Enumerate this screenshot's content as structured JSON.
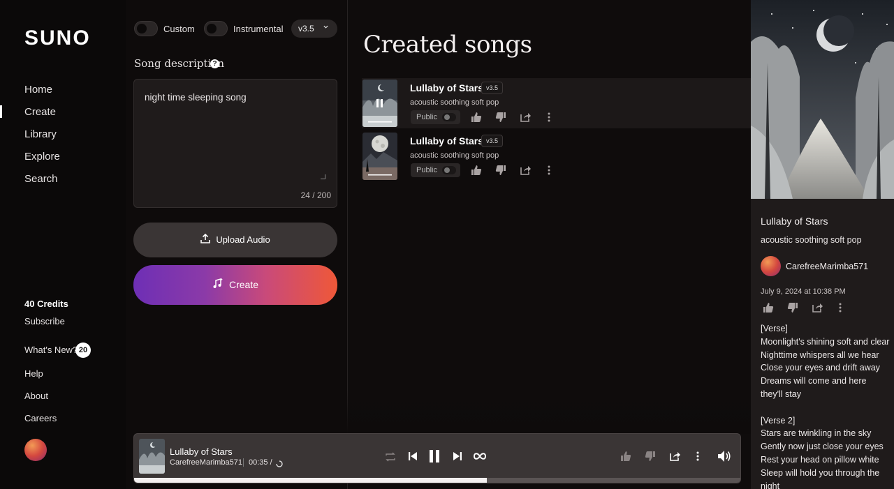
{
  "brand": "SUNO",
  "nav": [
    {
      "label": "Home"
    },
    {
      "label": "Create"
    },
    {
      "label": "Library"
    },
    {
      "label": "Explore"
    },
    {
      "label": "Search"
    }
  ],
  "active_nav": "Create",
  "sidebar": {
    "credits": "40 Credits",
    "subscribe": "Subscribe",
    "whats_new": "What's New?",
    "whats_new_count": "20",
    "help": "Help",
    "about": "About",
    "careers": "Careers"
  },
  "create": {
    "custom_label": "Custom",
    "instrumental_label": "Instrumental",
    "version": "v3.5",
    "description_label": "Song description",
    "help_glyph": "?",
    "description_value": "night time sleeping song",
    "char_count": "24 / 200",
    "upload_label": "Upload Audio",
    "create_label": "Create"
  },
  "songs": {
    "title": "Created songs",
    "items": [
      {
        "title": "Lullaby of Stars",
        "version": "v3.5",
        "style": "acoustic soothing soft pop",
        "visibility": "Public",
        "playing": true
      },
      {
        "title": "Lullaby of Stars",
        "version": "v3.5",
        "style": "acoustic soothing soft pop",
        "visibility": "Public",
        "playing": false
      }
    ]
  },
  "detail": {
    "title": "Lullaby of Stars",
    "style": "acoustic soothing soft pop",
    "user": "CarefreeMarimba571",
    "date": "July 9, 2024 at 10:38 PM",
    "lyrics": "[Verse]\nMoonlight's shining soft and clear\nNighttime whispers all we hear\nClose your eyes and drift away\nDreams will come and here they'll stay\n\n[Verse 2]\nStars are twinkling in the sky\nGently now just close your eyes\nRest your head on pillow white\nSleep will hold you through the night"
  },
  "player": {
    "title": "Lullaby of Stars",
    "user": "CarefreeMarimba571",
    "time": "00:35 /",
    "progress": 0.58
  },
  "icons": {
    "like": "thumbs-up-icon",
    "dislike": "thumbs-down-icon",
    "share": "share-icon",
    "more": "more-vertical-icon",
    "upload": "upload-icon",
    "create": "music-sparkle-icon",
    "repeat": "repeat-icon",
    "prev": "skip-back-icon",
    "pause": "pause-icon",
    "next": "skip-forward-icon",
    "loop": "infinity-icon",
    "volume": "volume-icon",
    "loading": "spinner-icon"
  }
}
